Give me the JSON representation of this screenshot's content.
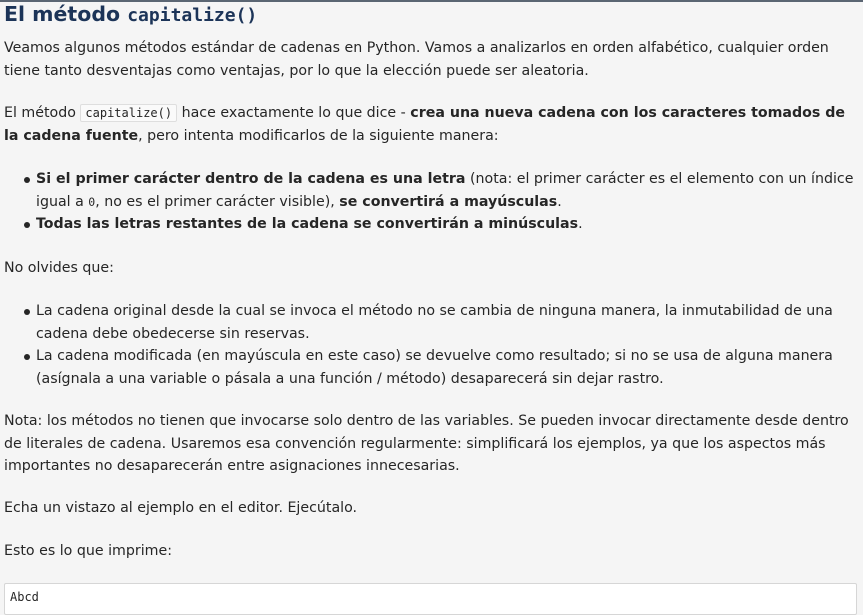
{
  "heading": {
    "text": "El método ",
    "code": "capitalize()"
  },
  "intro": "Veamos algunos métodos estándar de cadenas en Python. Vamos a analizarlos en orden alfabético, cualquier orden tiene tanto desventajas como ventajas, por lo que la elección puede ser aleatoria.",
  "method_paragraph": {
    "before": "El método ",
    "code": "capitalize()",
    "middle": " hace exactamente lo que dice - ",
    "bold": "crea una nueva cadena con los caracteres tomados de la cadena fuente",
    "after": ", pero intenta modificarlos de la siguiente manera:"
  },
  "rules": {
    "item1": {
      "bold1": "Si el primer carácter dentro de la cadena es una letra",
      "text1": " (nota: el primer carácter es el elemento con un índice igual a ",
      "code": "0",
      "text2": ", no es el primer carácter visible), ",
      "bold2": "se convertirá a mayúsculas",
      "end": "."
    },
    "item2": {
      "bold": "Todas las letras restantes de la cadena se convertirán a minúsculas",
      "end": "."
    }
  },
  "remember_label": "No olvides que:",
  "remember_items": [
    "La cadena original desde la cual se invoca el método no se cambia de ninguna manera, la inmutabilidad de una cadena debe obedecerse sin reservas.",
    "La cadena modificada (en mayúscula en este caso) se devuelve como resultado; si no se usa de alguna manera (asígnala a una variable o pásala a una función / método) desaparecerá sin dejar rastro."
  ],
  "note": "Nota: los métodos no tienen que invocarse solo dentro de las variables. Se pueden invocar directamente desde dentro de literales de cadena. Usaremos esa convención regularmente: simplificará los ejemplos, ya que los aspectos más importantes no desaparecerán entre asignaciones innecesarias.",
  "editor_hint": "Echa un vistazo al ejemplo en el editor. Ejecútalo.",
  "prints_label": "Esto es lo que imprime:",
  "output": "Abcd"
}
